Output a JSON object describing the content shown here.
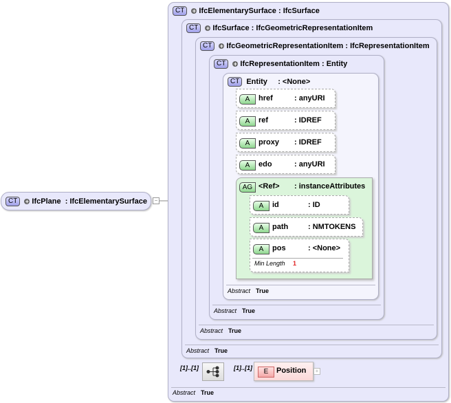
{
  "root": {
    "badge": "CT",
    "name": "IfcPlane",
    "type": ": IfcElementarySurface"
  },
  "types": [
    {
      "badge": "CT",
      "name": "IfcElementarySurface",
      "type": ": IfcSurface",
      "abstract_label": "Abstract",
      "abstract_value": "True"
    },
    {
      "badge": "CT",
      "name": "IfcSurface",
      "type": ": IfcGeometricRepresentationItem",
      "abstract_label": "Abstract",
      "abstract_value": "True"
    },
    {
      "badge": "CT",
      "name": "IfcGeometricRepresentationItem",
      "type": ": IfcRepresentationItem",
      "abstract_label": "Abstract",
      "abstract_value": "True"
    },
    {
      "badge": "CT",
      "name": "IfcRepresentationItem",
      "type": ": Entity",
      "abstract_label": "Abstract",
      "abstract_value": "True"
    },
    {
      "badge": "CT",
      "name": "Entity",
      "type": ": <None>",
      "abstract_label": "Abstract",
      "abstract_value": "True"
    }
  ],
  "attributes": [
    {
      "badge": "A",
      "name": "href",
      "type": ": anyURI"
    },
    {
      "badge": "A",
      "name": "ref",
      "type": ": IDREF"
    },
    {
      "badge": "A",
      "name": "proxy",
      "type": ": IDREF"
    },
    {
      "badge": "A",
      "name": "edo",
      "type": ": anyURI"
    }
  ],
  "attribute_group": {
    "badge": "AG",
    "name": "<Ref>",
    "type": ": instanceAttributes",
    "attributes": [
      {
        "badge": "A",
        "name": "id",
        "type": ": ID"
      },
      {
        "badge": "A",
        "name": "path",
        "type": ": NMTOKENS"
      },
      {
        "badge": "A",
        "name": "pos",
        "type": ": <None>",
        "facet_label": "Min Length",
        "facet_value": "1"
      }
    ]
  },
  "sequence": {
    "occurrence": "[1]..[1]"
  },
  "element": {
    "badge": "E",
    "name": "Position",
    "occurrence": "[1]..[1]"
  }
}
